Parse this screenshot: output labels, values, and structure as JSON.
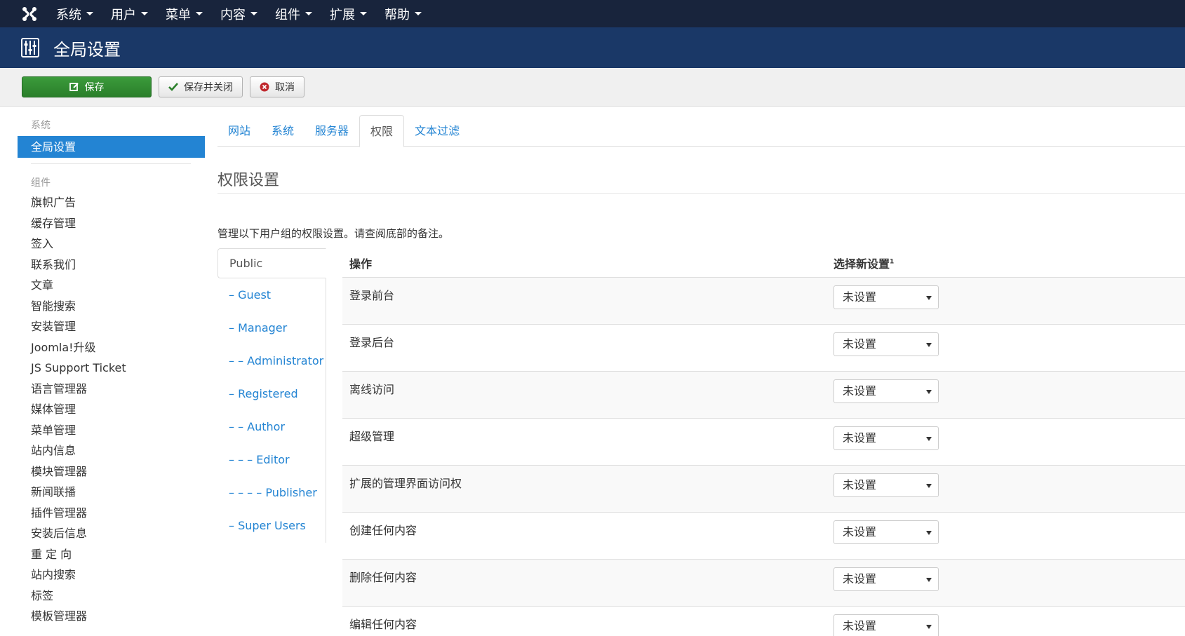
{
  "navbar": {
    "items": [
      {
        "label": "系统"
      },
      {
        "label": "用户"
      },
      {
        "label": "菜单"
      },
      {
        "label": "内容"
      },
      {
        "label": "组件"
      },
      {
        "label": "扩展"
      },
      {
        "label": "帮助"
      }
    ]
  },
  "titlebar": {
    "title": "全局设置"
  },
  "toolbar": {
    "save": "保存",
    "save_close": "保存并关闭",
    "cancel": "取消"
  },
  "sidebar": {
    "header_system": "系统",
    "active_item": "全局设置",
    "header_components": "组件",
    "items": [
      {
        "label": "旗帜广告"
      },
      {
        "label": "缓存管理"
      },
      {
        "label": "签入"
      },
      {
        "label": "联系我们"
      },
      {
        "label": "文章"
      },
      {
        "label": "智能搜索"
      },
      {
        "label": "安装管理"
      },
      {
        "label": "Joomla!升级"
      },
      {
        "label": "JS Support Ticket"
      },
      {
        "label": "语言管理器"
      },
      {
        "label": "媒体管理"
      },
      {
        "label": "菜单管理"
      },
      {
        "label": "站内信息"
      },
      {
        "label": "模块管理器"
      },
      {
        "label": "新闻联播"
      },
      {
        "label": "插件管理器"
      },
      {
        "label": "安装后信息"
      },
      {
        "label": "重 定 向"
      },
      {
        "label": "站内搜索"
      },
      {
        "label": "标签"
      },
      {
        "label": "模板管理器"
      }
    ]
  },
  "tabs": [
    {
      "label": "网站",
      "active": false
    },
    {
      "label": "系统",
      "active": false
    },
    {
      "label": "服务器",
      "active": false
    },
    {
      "label": "权限",
      "active": true
    },
    {
      "label": "文本过滤",
      "active": false
    }
  ],
  "main": {
    "section_title": "权限设置",
    "description": "管理以下用户组的权限设置。请查阅底部的备注。"
  },
  "groups": [
    {
      "label": "Public"
    },
    {
      "label": "– Guest"
    },
    {
      "label": "– Manager"
    },
    {
      "label": "– – Administrator"
    },
    {
      "label": "– Registered"
    },
    {
      "label": "– – Author"
    },
    {
      "label": "– – – Editor"
    },
    {
      "label": "– – – – Publisher"
    },
    {
      "label": "– Super Users"
    }
  ],
  "permissions": {
    "head_action": "操作",
    "head_setting": "选择新设置",
    "head_sup": "1",
    "rows": [
      {
        "action": "登录前台",
        "value": "未设置"
      },
      {
        "action": "登录后台",
        "value": "未设置"
      },
      {
        "action": "离线访问",
        "value": "未设置"
      },
      {
        "action": "超级管理",
        "value": "未设置"
      },
      {
        "action": "扩展的管理界面访问权",
        "value": "未设置"
      },
      {
        "action": "创建任何内容",
        "value": "未设置"
      },
      {
        "action": "删除任何内容",
        "value": "未设置"
      },
      {
        "action": "编辑任何内容",
        "value": "未设置"
      }
    ]
  }
}
